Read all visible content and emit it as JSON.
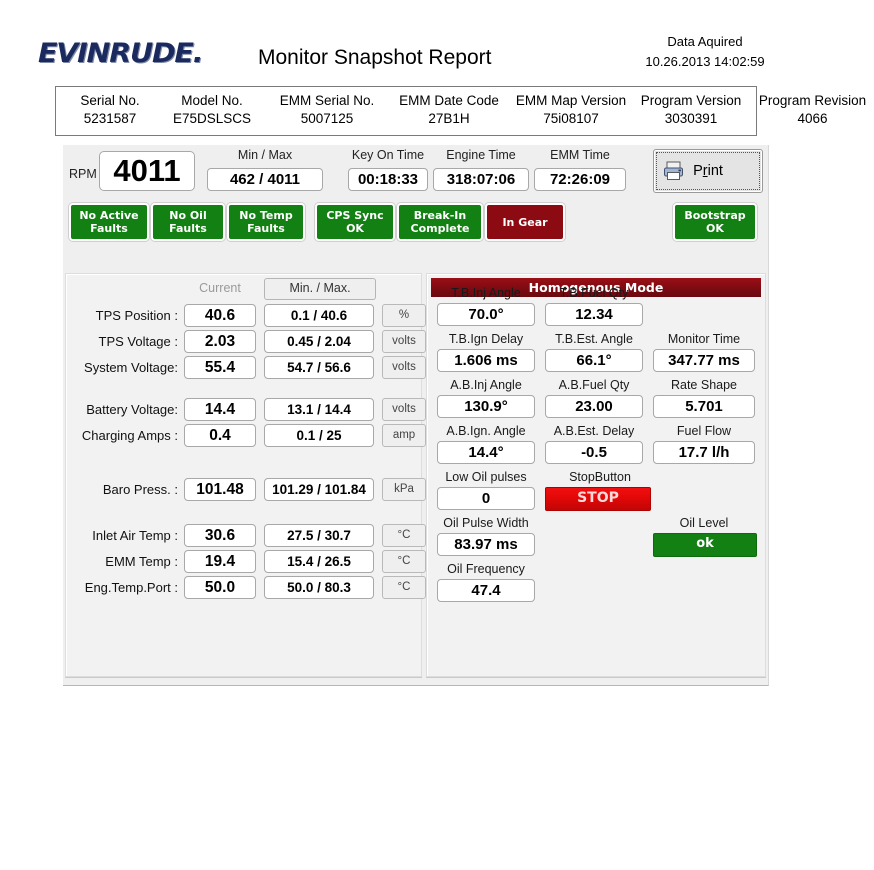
{
  "header": {
    "logo": "EVINRUDE",
    "logo_dot": ".",
    "title": "Monitor Snapshot Report",
    "acquired_label": "Data Aquired",
    "acquired_value": "10.26.2013 14:02:59"
  },
  "serial": {
    "columns": [
      {
        "label": "Serial No.",
        "value": "5231587"
      },
      {
        "label": "Model No.",
        "value": "E75DSLSCS"
      },
      {
        "label": "EMM Serial No.",
        "value": "5007125"
      },
      {
        "label": "EMM Date Code",
        "value": "27B1H"
      },
      {
        "label": "EMM Map Version",
        "value": "75i08107"
      },
      {
        "label": "Program Version",
        "value": "3030391"
      },
      {
        "label": "Program Revision",
        "value": "4066"
      }
    ]
  },
  "rpm_row": {
    "rpm_label": "RPM",
    "rpm_value": "4011",
    "minmax_caption": "Min / Max",
    "minmax_value": "462 / 4011",
    "key_on_caption": "Key On Time",
    "key_on_value": "00:18:33",
    "engine_caption": "Engine Time",
    "engine_value": "318:07:06",
    "emm_caption": "EMM Time",
    "emm_value": "72:26:09",
    "print_label_pre": "P",
    "print_label_u": "r",
    "print_label_post": "int",
    "print_icon": "printer-icon"
  },
  "status_buttons": [
    {
      "name": "no-active-faults",
      "line1": "No Active",
      "line2": "Faults",
      "state": "green"
    },
    {
      "name": "no-oil-faults",
      "line1": "No Oil",
      "line2": "Faults",
      "state": "green"
    },
    {
      "name": "no-temp-faults",
      "line1": "No Temp",
      "line2": "Faults",
      "state": "green"
    },
    {
      "name": "cps-sync",
      "line1": "CPS Sync",
      "line2": "OK",
      "state": "green"
    },
    {
      "name": "break-in",
      "line1": "Break-In",
      "line2": "Complete",
      "state": "green"
    },
    {
      "name": "in-gear",
      "line1": "In Gear",
      "line2": "",
      "state": "red"
    },
    {
      "name": "bootstrap",
      "line1": "Bootstrap",
      "line2": "OK",
      "state": "green"
    }
  ],
  "left_panel": {
    "current_header": "Current",
    "minmax_header": "Min. / Max.",
    "rows": [
      {
        "label": "TPS Position :",
        "current": "40.6",
        "minmax": "0.1 / 40.6",
        "unit": "%"
      },
      {
        "label": "TPS Voltage :",
        "current": "2.03",
        "minmax": "0.45 / 2.04",
        "unit": "volts"
      },
      {
        "label": "System Voltage:",
        "current": "55.4",
        "minmax": "54.7 / 56.6",
        "unit": "volts"
      },
      {
        "label": "Battery Voltage:",
        "current": "14.4",
        "minmax": "13.1 / 14.4",
        "unit": "volts"
      },
      {
        "label": "Charging Amps :",
        "current": "0.4",
        "minmax": "0.1 / 25",
        "unit": "amp"
      },
      {
        "label": "Baro Press. :",
        "current": "101.48",
        "minmax": "101.29 / 101.84",
        "unit": "kPa"
      },
      {
        "label": "Inlet Air Temp :",
        "current": "30.6",
        "minmax": "27.5 / 30.7",
        "unit": "°C"
      },
      {
        "label": "EMM Temp :",
        "current": "19.4",
        "minmax": "15.4 / 26.5",
        "unit": "°C"
      },
      {
        "label": "Eng.Temp.Port :",
        "current": "50.0",
        "minmax": "50.0 / 80.3",
        "unit": "°C"
      }
    ]
  },
  "right_panel": {
    "mode_title": "Homogenous Mode",
    "fields": [
      {
        "caption": "T.B.Inj Angle",
        "value": "70.0°"
      },
      {
        "caption": "T.B.Fuel Qty",
        "value": "12.34"
      },
      {
        "caption": "T.B.Ign Delay",
        "value": "1.606 ms"
      },
      {
        "caption": "T.B.Est. Angle",
        "value": "66.1°"
      },
      {
        "caption": "Monitor Time",
        "value": "347.77 ms"
      },
      {
        "caption": "A.B.Inj Angle",
        "value": "130.9°"
      },
      {
        "caption": "A.B.Fuel Qty",
        "value": "23.00"
      },
      {
        "caption": "Rate Shape",
        "value": "5.701"
      },
      {
        "caption": "A.B.Ign. Angle",
        "value": "14.4°"
      },
      {
        "caption": "A.B.Est. Delay",
        "value": "-0.5"
      },
      {
        "caption": "Fuel Flow",
        "value": "17.7 l/h"
      },
      {
        "caption": "Low Oil pulses",
        "value": "0"
      },
      {
        "caption": "Oil Pulse Width",
        "value": "83.97 ms"
      },
      {
        "caption": "Oil Frequency",
        "value": "47.4"
      }
    ],
    "stop_caption": "StopButton",
    "stop_label": "STOP",
    "oil_level_caption": "Oil Level",
    "oil_level_value": "ok"
  },
  "colors": {
    "green": "#128012",
    "red": "#8c0b12",
    "stop_red": "#e20808",
    "mode_header": "#7d0b12",
    "logo_blue": "#1b2a5e"
  }
}
